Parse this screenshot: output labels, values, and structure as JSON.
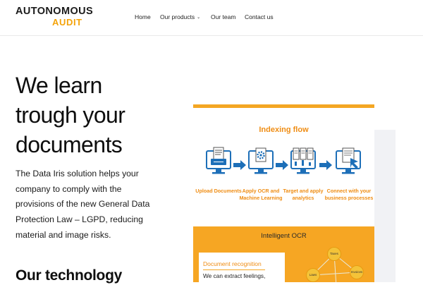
{
  "logo": {
    "line1": "AUTONOMOUS",
    "line2": "AUDIT"
  },
  "nav": {
    "items": [
      {
        "label": "Home"
      },
      {
        "label": "Our products",
        "has_dropdown": true
      },
      {
        "label": "Our team"
      },
      {
        "label": "Contact us"
      }
    ]
  },
  "hero": {
    "title_lines": [
      "We learn",
      "trough your",
      "documents"
    ],
    "text": "The Data Iris solution helps your company to comply with the provisions of the new General Data Protection Law – LGPD, reducing material and image risks.",
    "next_heading": "Our technology"
  },
  "flow": {
    "title": "Indexing flow",
    "accent_color": "#ef8d14",
    "icon_color": "#1d6fb8",
    "steps": [
      {
        "label": "Upload Documents",
        "icon": "upload-document-monitor-icon"
      },
      {
        "label": "Apply OCR and Machine Learning",
        "icon": "ocr-gear-monitor-icon"
      },
      {
        "label": "Target and apply analytics",
        "icon": "analytics-documents-monitor-icon"
      },
      {
        "label": "Connect with your business processes",
        "icon": "business-process-monitor-icon"
      }
    ]
  },
  "ocr": {
    "title": "Intelligent OCR",
    "box_title": "Document recognition",
    "box_text": "We can extract feelings,",
    "nodes": [
      "Taxes",
      "Laws",
      "Invoices"
    ]
  }
}
